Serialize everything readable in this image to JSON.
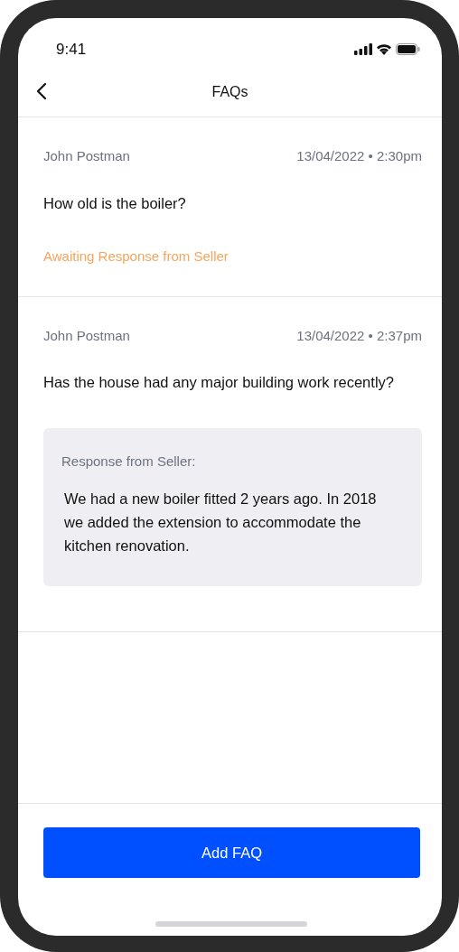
{
  "status_bar": {
    "time": "9:41"
  },
  "header": {
    "title": "FAQs"
  },
  "faqs": [
    {
      "author": "John Postman",
      "timestamp": "13/04/2022 • 2:30pm",
      "question": "How old is the boiler?",
      "status": "Awaiting Response from Seller"
    },
    {
      "author": "John Postman",
      "timestamp": "13/04/2022 • 2:37pm",
      "question": "Has the house had any major building work recently?",
      "response": {
        "label": "Response from Seller:",
        "text": "We had a new boiler fitted 2 years ago. In 2018 we added the extension to accommodate the kitchen renovation."
      }
    }
  ],
  "buttons": [
    {
      "label": "Add FAQ"
    }
  ]
}
